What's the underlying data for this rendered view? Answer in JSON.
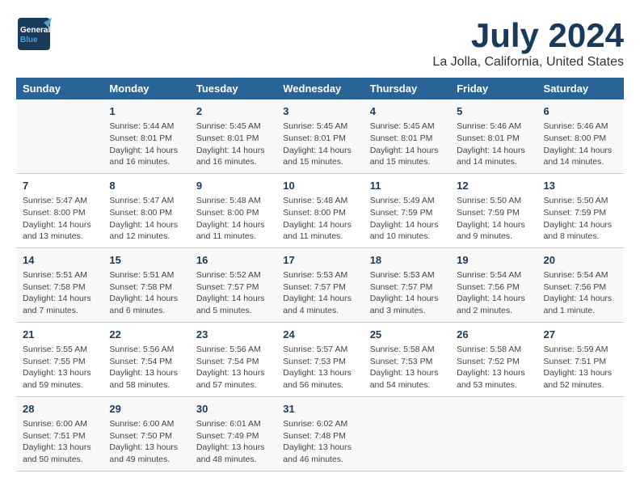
{
  "logo": {
    "general": "General",
    "blue": "Blue"
  },
  "title": "July 2024",
  "location": "La Jolla, California, United States",
  "days_of_week": [
    "Sunday",
    "Monday",
    "Tuesday",
    "Wednesday",
    "Thursday",
    "Friday",
    "Saturday"
  ],
  "weeks": [
    [
      {
        "day": "",
        "info": ""
      },
      {
        "day": "1",
        "info": "Sunrise: 5:44 AM\nSunset: 8:01 PM\nDaylight: 14 hours\nand 16 minutes."
      },
      {
        "day": "2",
        "info": "Sunrise: 5:45 AM\nSunset: 8:01 PM\nDaylight: 14 hours\nand 16 minutes."
      },
      {
        "day": "3",
        "info": "Sunrise: 5:45 AM\nSunset: 8:01 PM\nDaylight: 14 hours\nand 15 minutes."
      },
      {
        "day": "4",
        "info": "Sunrise: 5:45 AM\nSunset: 8:01 PM\nDaylight: 14 hours\nand 15 minutes."
      },
      {
        "day": "5",
        "info": "Sunrise: 5:46 AM\nSunset: 8:01 PM\nDaylight: 14 hours\nand 14 minutes."
      },
      {
        "day": "6",
        "info": "Sunrise: 5:46 AM\nSunset: 8:00 PM\nDaylight: 14 hours\nand 14 minutes."
      }
    ],
    [
      {
        "day": "7",
        "info": "Sunrise: 5:47 AM\nSunset: 8:00 PM\nDaylight: 14 hours\nand 13 minutes."
      },
      {
        "day": "8",
        "info": "Sunrise: 5:47 AM\nSunset: 8:00 PM\nDaylight: 14 hours\nand 12 minutes."
      },
      {
        "day": "9",
        "info": "Sunrise: 5:48 AM\nSunset: 8:00 PM\nDaylight: 14 hours\nand 11 minutes."
      },
      {
        "day": "10",
        "info": "Sunrise: 5:48 AM\nSunset: 8:00 PM\nDaylight: 14 hours\nand 11 minutes."
      },
      {
        "day": "11",
        "info": "Sunrise: 5:49 AM\nSunset: 7:59 PM\nDaylight: 14 hours\nand 10 minutes."
      },
      {
        "day": "12",
        "info": "Sunrise: 5:50 AM\nSunset: 7:59 PM\nDaylight: 14 hours\nand 9 minutes."
      },
      {
        "day": "13",
        "info": "Sunrise: 5:50 AM\nSunset: 7:59 PM\nDaylight: 14 hours\nand 8 minutes."
      }
    ],
    [
      {
        "day": "14",
        "info": "Sunrise: 5:51 AM\nSunset: 7:58 PM\nDaylight: 14 hours\nand 7 minutes."
      },
      {
        "day": "15",
        "info": "Sunrise: 5:51 AM\nSunset: 7:58 PM\nDaylight: 14 hours\nand 6 minutes."
      },
      {
        "day": "16",
        "info": "Sunrise: 5:52 AM\nSunset: 7:57 PM\nDaylight: 14 hours\nand 5 minutes."
      },
      {
        "day": "17",
        "info": "Sunrise: 5:53 AM\nSunset: 7:57 PM\nDaylight: 14 hours\nand 4 minutes."
      },
      {
        "day": "18",
        "info": "Sunrise: 5:53 AM\nSunset: 7:57 PM\nDaylight: 14 hours\nand 3 minutes."
      },
      {
        "day": "19",
        "info": "Sunrise: 5:54 AM\nSunset: 7:56 PM\nDaylight: 14 hours\nand 2 minutes."
      },
      {
        "day": "20",
        "info": "Sunrise: 5:54 AM\nSunset: 7:56 PM\nDaylight: 14 hours\nand 1 minute."
      }
    ],
    [
      {
        "day": "21",
        "info": "Sunrise: 5:55 AM\nSunset: 7:55 PM\nDaylight: 13 hours\nand 59 minutes."
      },
      {
        "day": "22",
        "info": "Sunrise: 5:56 AM\nSunset: 7:54 PM\nDaylight: 13 hours\nand 58 minutes."
      },
      {
        "day": "23",
        "info": "Sunrise: 5:56 AM\nSunset: 7:54 PM\nDaylight: 13 hours\nand 57 minutes."
      },
      {
        "day": "24",
        "info": "Sunrise: 5:57 AM\nSunset: 7:53 PM\nDaylight: 13 hours\nand 56 minutes."
      },
      {
        "day": "25",
        "info": "Sunrise: 5:58 AM\nSunset: 7:53 PM\nDaylight: 13 hours\nand 54 minutes."
      },
      {
        "day": "26",
        "info": "Sunrise: 5:58 AM\nSunset: 7:52 PM\nDaylight: 13 hours\nand 53 minutes."
      },
      {
        "day": "27",
        "info": "Sunrise: 5:59 AM\nSunset: 7:51 PM\nDaylight: 13 hours\nand 52 minutes."
      }
    ],
    [
      {
        "day": "28",
        "info": "Sunrise: 6:00 AM\nSunset: 7:51 PM\nDaylight: 13 hours\nand 50 minutes."
      },
      {
        "day": "29",
        "info": "Sunrise: 6:00 AM\nSunset: 7:50 PM\nDaylight: 13 hours\nand 49 minutes."
      },
      {
        "day": "30",
        "info": "Sunrise: 6:01 AM\nSunset: 7:49 PM\nDaylight: 13 hours\nand 48 minutes."
      },
      {
        "day": "31",
        "info": "Sunrise: 6:02 AM\nSunset: 7:48 PM\nDaylight: 13 hours\nand 46 minutes."
      },
      {
        "day": "",
        "info": ""
      },
      {
        "day": "",
        "info": ""
      },
      {
        "day": "",
        "info": ""
      }
    ]
  ]
}
